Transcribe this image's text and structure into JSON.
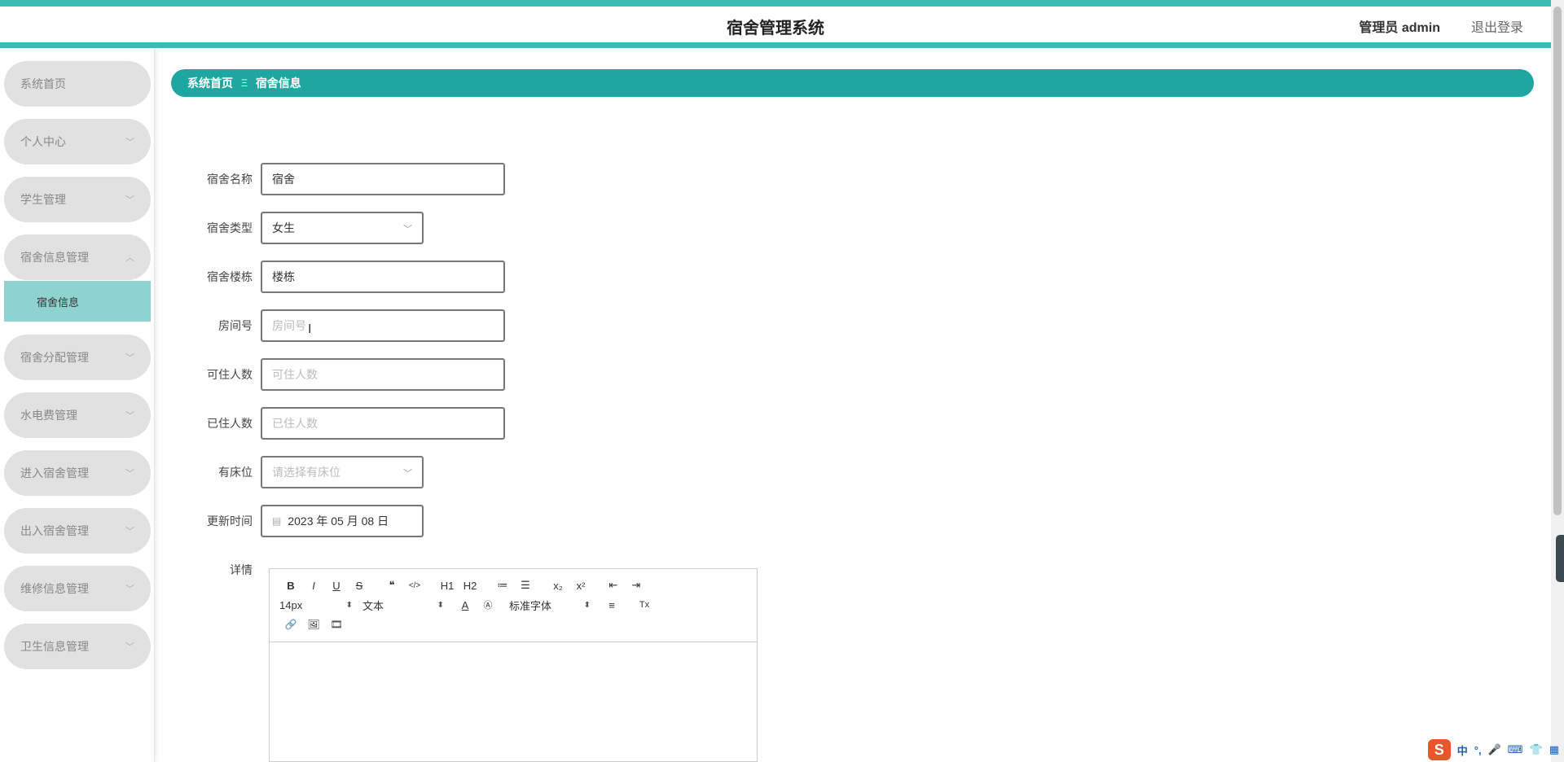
{
  "header": {
    "title": "宿舍管理系统",
    "user": "管理员 admin",
    "logout": "退出登录"
  },
  "sidebar": {
    "items": [
      {
        "label": "系统首页",
        "chevron": ""
      },
      {
        "label": "个人中心",
        "chevron": "﹀"
      },
      {
        "label": "学生管理",
        "chevron": "﹀"
      },
      {
        "label": "宿舍信息管理",
        "chevron": "︿"
      },
      {
        "label": "宿舍分配管理",
        "chevron": "﹀"
      },
      {
        "label": "水电费管理",
        "chevron": "﹀"
      },
      {
        "label": "进入宿舍管理",
        "chevron": "﹀"
      },
      {
        "label": "出入宿舍管理",
        "chevron": "﹀"
      },
      {
        "label": "维修信息管理",
        "chevron": "﹀"
      },
      {
        "label": "卫生信息管理",
        "chevron": "﹀"
      }
    ],
    "sub_item": "宿舍信息"
  },
  "breadcrumb": {
    "home": "系统首页",
    "sep": "Ξ",
    "current": "宿舍信息"
  },
  "form": {
    "dorm_name": {
      "label": "宿舍名称",
      "value": "宿舍"
    },
    "dorm_type": {
      "label": "宿舍类型",
      "value": "女生"
    },
    "building": {
      "label": "宿舍楼栋",
      "value": "楼栋"
    },
    "room_no": {
      "label": "房间号",
      "placeholder": "房间号"
    },
    "capacity": {
      "label": "可住人数",
      "placeholder": "可住人数"
    },
    "occupied": {
      "label": "已住人数",
      "placeholder": "已住人数"
    },
    "bed_available": {
      "label": "有床位",
      "placeholder": "请选择有床位"
    },
    "update_time": {
      "label": "更新时间",
      "value": "2023 年 05 月 08 日"
    },
    "details": {
      "label": "详情"
    }
  },
  "editor": {
    "font_size": "14px",
    "format": "文本",
    "font_family": "标准字体",
    "buttons_row1": [
      "B",
      "I",
      "U",
      "S",
      "❝",
      "</>",
      "H1",
      "H2",
      "≔",
      "☰",
      "x₂",
      "x²",
      "⇤",
      "⇥"
    ],
    "buttons_row2_extra": [
      "A",
      "Ⓐ",
      "≡",
      "Tx"
    ],
    "buttons_row3": [
      "🔗",
      "🖼",
      "🎞"
    ]
  },
  "ime": {
    "logo": "S",
    "lang": "中",
    "punct": "°,",
    "mic": "🎤",
    "kbd": "⌨",
    "shirt": "👕",
    "grid": "▦"
  }
}
